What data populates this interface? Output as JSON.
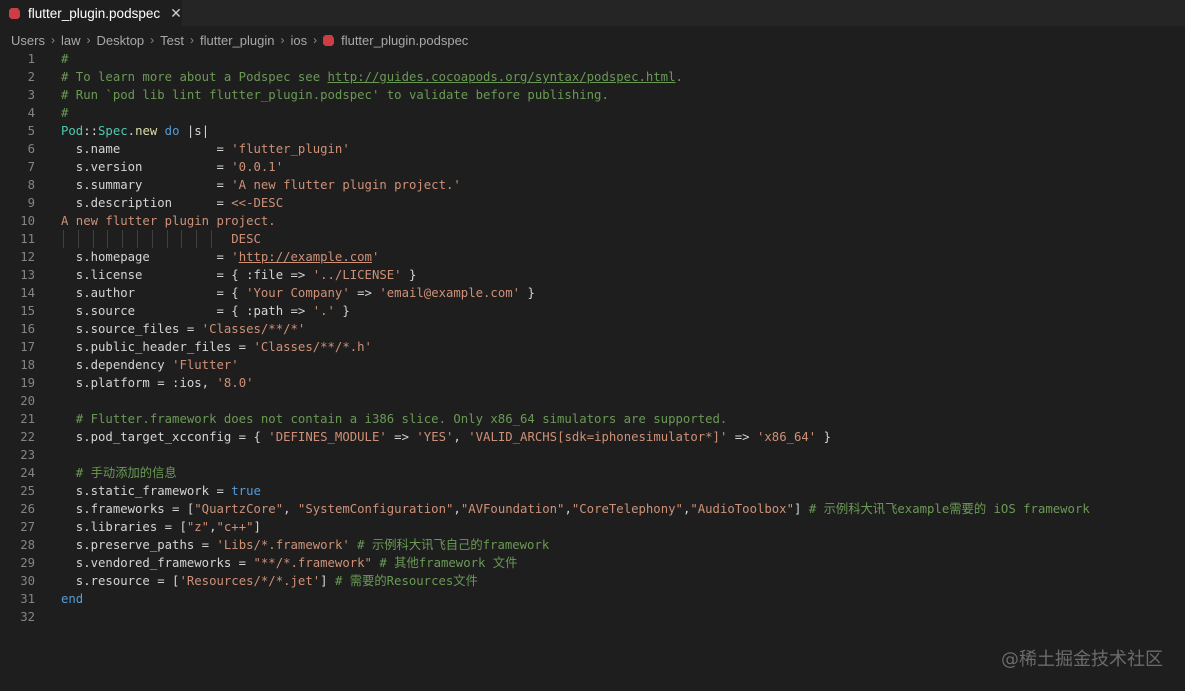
{
  "tab": {
    "title": "flutter_plugin.podspec",
    "close": "✕"
  },
  "breadcrumb": [
    "Users",
    "law",
    "Desktop",
    "Test",
    "flutter_plugin",
    "ios",
    "flutter_plugin.podspec"
  ],
  "lines": [
    [
      [
        "cm",
        "#"
      ]
    ],
    [
      [
        "cm",
        "# To learn more about a Podspec see "
      ],
      [
        "cmurl",
        "http://guides.cocoapods.org/syntax/podspec.html"
      ],
      [
        "cm",
        "."
      ]
    ],
    [
      [
        "cm",
        "# Run `pod lib lint flutter_plugin.podspec' to validate before publishing."
      ]
    ],
    [
      [
        "cm",
        "#"
      ]
    ],
    [
      [
        "cls",
        "Pod"
      ],
      [
        "",
        "::"
      ],
      [
        "cls",
        "Spec"
      ],
      [
        "",
        "."
      ],
      [
        "fn",
        "new"
      ],
      [
        "kw",
        " do"
      ],
      [
        "",
        " |s|"
      ]
    ],
    [
      [
        "",
        "  s.name             = "
      ],
      [
        "str",
        "'flutter_plugin'"
      ]
    ],
    [
      [
        "",
        "  s.version          = "
      ],
      [
        "str",
        "'0.0.1'"
      ]
    ],
    [
      [
        "",
        "  s.summary          = "
      ],
      [
        "str",
        "'A new flutter plugin project.'"
      ]
    ],
    [
      [
        "",
        "  s.description      = "
      ],
      [
        "str",
        "<<-DESC"
      ]
    ],
    [
      [
        "str",
        "A new flutter plugin project."
      ]
    ],
    [
      [
        "str",
        "                       DESC"
      ]
    ],
    [
      [
        "",
        "  s.homepage         = "
      ],
      [
        "str",
        "'"
      ],
      [
        "strurl",
        "http://example.com"
      ],
      [
        "str",
        "'"
      ]
    ],
    [
      [
        "",
        "  s.license          = { :file => "
      ],
      [
        "str",
        "'../LICENSE'"
      ],
      [
        "",
        " }"
      ]
    ],
    [
      [
        "",
        "  s.author           = { "
      ],
      [
        "str",
        "'Your Company'"
      ],
      [
        "",
        " => "
      ],
      [
        "str",
        "'email@example.com'"
      ],
      [
        "",
        " }"
      ]
    ],
    [
      [
        "",
        "  s.source           = { :path => "
      ],
      [
        "str",
        "'.'"
      ],
      [
        "",
        " }"
      ]
    ],
    [
      [
        "",
        "  s.source_files = "
      ],
      [
        "str",
        "'Classes/**/*'"
      ]
    ],
    [
      [
        "",
        "  s.public_header_files = "
      ],
      [
        "str",
        "'Classes/**/*.h'"
      ]
    ],
    [
      [
        "",
        "  s.dependency "
      ],
      [
        "str",
        "'Flutter'"
      ]
    ],
    [
      [
        "",
        "  s.platform = :ios, "
      ],
      [
        "str",
        "'8.0'"
      ]
    ],
    [],
    [
      [
        "cm",
        "  # Flutter.framework does not contain a i386 slice. Only x86_64 simulators are supported."
      ]
    ],
    [
      [
        "",
        "  s.pod_target_xcconfig = { "
      ],
      [
        "str",
        "'DEFINES_MODULE'"
      ],
      [
        "",
        " => "
      ],
      [
        "str",
        "'YES'"
      ],
      [
        "",
        ", "
      ],
      [
        "str",
        "'VALID_ARCHS[sdk=iphonesimulator*]'"
      ],
      [
        "",
        " => "
      ],
      [
        "str",
        "'x86_64'"
      ],
      [
        "",
        " }"
      ]
    ],
    [],
    [
      [
        "cm",
        "  # 手动添加的信息"
      ]
    ],
    [
      [
        "",
        "  s.static_framework = "
      ],
      [
        "kw",
        "true"
      ]
    ],
    [
      [
        "",
        "  s.frameworks = ["
      ],
      [
        "str",
        "\"QuartzCore\""
      ],
      [
        "",
        ", "
      ],
      [
        "str",
        "\"SystemConfiguration\""
      ],
      [
        "",
        ","
      ],
      [
        "str",
        "\"AVFoundation\""
      ],
      [
        "",
        ","
      ],
      [
        "str",
        "\"CoreTelephony\""
      ],
      [
        "",
        ","
      ],
      [
        "str",
        "\"AudioToolbox\""
      ],
      [
        "",
        "] "
      ],
      [
        "cm",
        "# 示例科大讯飞example需要的 iOS framework"
      ]
    ],
    [
      [
        "",
        "  s.libraries = ["
      ],
      [
        "str",
        "\"z\""
      ],
      [
        "",
        ","
      ],
      [
        "str",
        "\"c++\""
      ],
      [
        "",
        "]"
      ]
    ],
    [
      [
        "",
        "  s.preserve_paths = "
      ],
      [
        "str",
        "'Libs/*.framework'"
      ],
      [
        "",
        " "
      ],
      [
        "cm",
        "# 示例科大讯飞自己的framework"
      ]
    ],
    [
      [
        "",
        "  s.vendored_frameworks = "
      ],
      [
        "str",
        "\"**/*.framework\""
      ],
      [
        "",
        " "
      ],
      [
        "cm",
        "# 其他framework 文件"
      ]
    ],
    [
      [
        "",
        "  s.resource = ["
      ],
      [
        "str",
        "'Resources/*/*.jet'"
      ],
      [
        "",
        "] "
      ],
      [
        "cm",
        "# 需要的Resources文件"
      ]
    ],
    [
      [
        "kw",
        "end"
      ]
    ],
    []
  ],
  "watermark": "@稀土掘金技术社区",
  "colors": {
    "background": "#1e1e1e",
    "comment": "#6a9955",
    "string": "#ce9178",
    "keyword": "#569cd6",
    "type": "#4ec9b0",
    "method": "#dcdcaa",
    "text": "#d4d4d4",
    "line_number": "#858585",
    "ruby_icon": "#cc3e44"
  }
}
